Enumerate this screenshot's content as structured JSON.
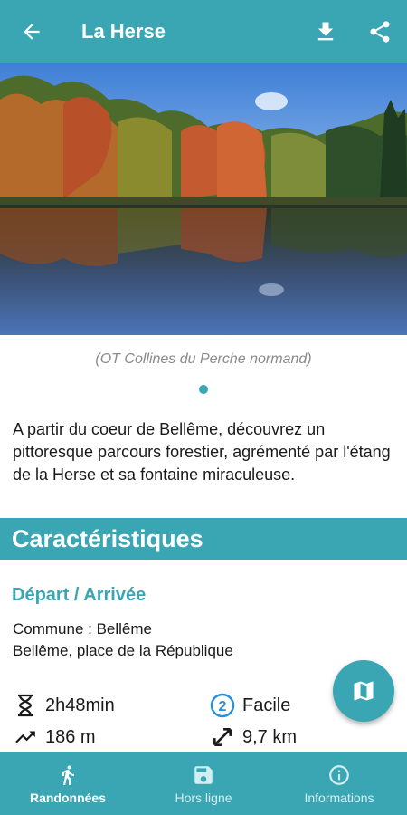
{
  "header": {
    "title": "La Herse",
    "back_icon": "arrow-back-icon",
    "download_icon": "download-icon",
    "share_icon": "share-icon"
  },
  "hero": {
    "credit": "(OT Collines du Perche normand)",
    "slide_count": 1,
    "active_slide": 1
  },
  "description": "A partir du coeur de Bellême, découvrez un pittoresque parcours forestier, agrémenté par l'étang de la Herse et sa fontaine miraculeuse.",
  "section": {
    "title": "Caractéristiques"
  },
  "depart": {
    "heading": "Départ / Arrivée",
    "commune": "Commune : Bellême",
    "place": "Bellême, place de la République"
  },
  "stats": {
    "duration": "2h48min",
    "difficulty_number": "2",
    "difficulty": "Facile",
    "elevation": "186 m",
    "distance": "9,7 km"
  },
  "nav": {
    "items": [
      {
        "label": "Randonnées",
        "icon": "hiker-icon",
        "active": true
      },
      {
        "label": "Hors ligne",
        "icon": "save-icon",
        "active": false
      },
      {
        "label": "Informations",
        "icon": "info-icon",
        "active": false
      }
    ]
  },
  "colors": {
    "primary": "#3aa6b4",
    "text": "#1a1a1a",
    "credit": "#8a8a8a"
  }
}
